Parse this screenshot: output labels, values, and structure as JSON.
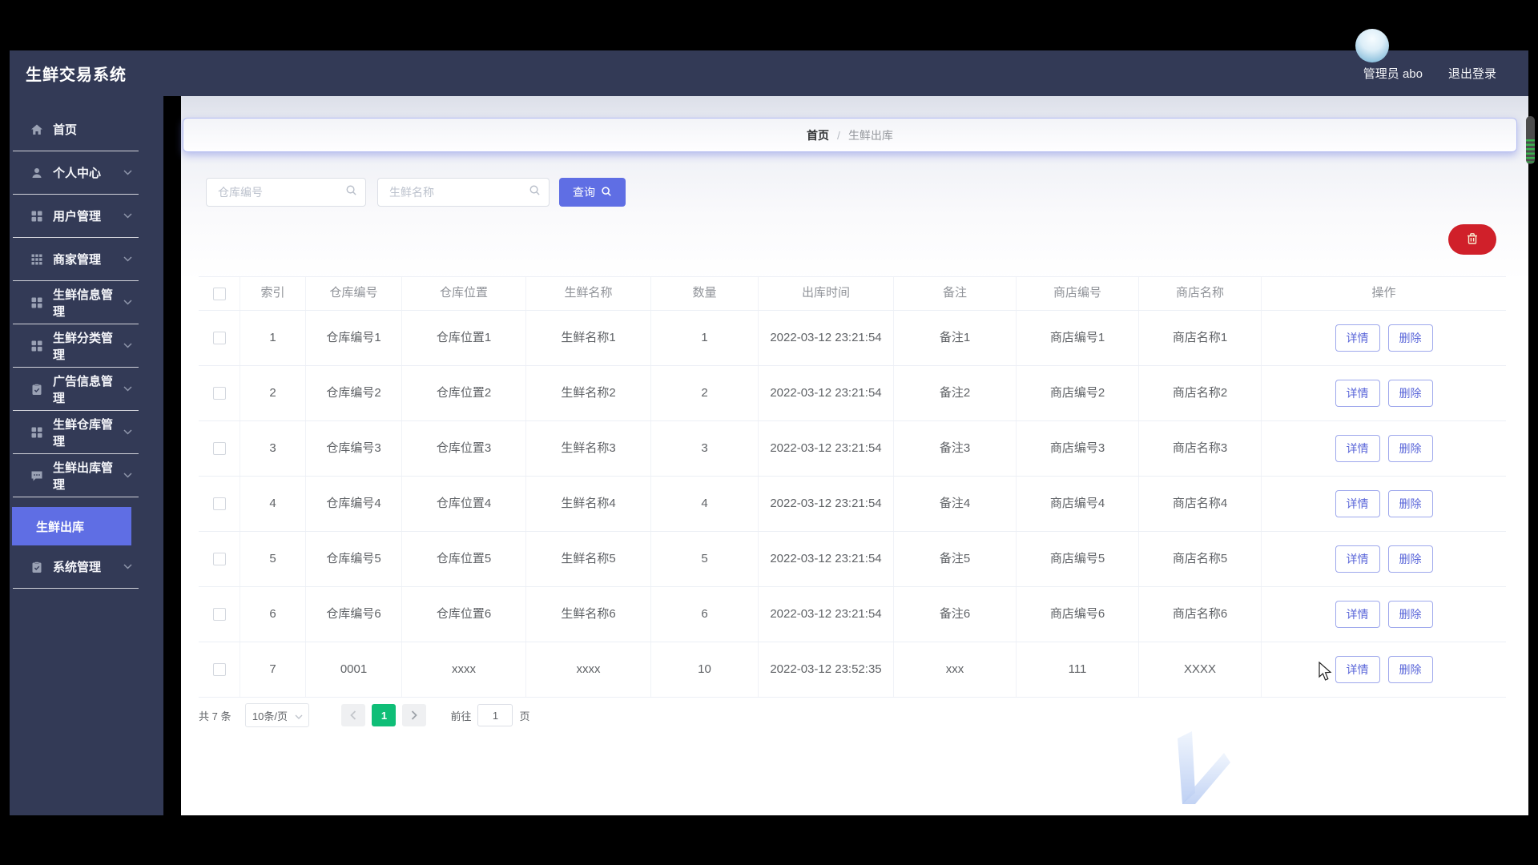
{
  "app": {
    "title": "生鲜交易系统",
    "user": "管理员 abo",
    "logout": "退出登录"
  },
  "sidebar": {
    "items": [
      {
        "label": "首页",
        "icon": "home-icon",
        "chevron": false
      },
      {
        "label": "个人中心",
        "icon": "user-icon",
        "chevron": true
      },
      {
        "label": "用户管理",
        "icon": "grid-icon",
        "chevron": true
      },
      {
        "label": "商家管理",
        "icon": "dots-grid-icon",
        "chevron": true
      },
      {
        "label": "生鲜信息管理",
        "icon": "grid-icon",
        "chevron": true
      },
      {
        "label": "生鲜分类管理",
        "icon": "grid-icon",
        "chevron": true
      },
      {
        "label": "广告信息管理",
        "icon": "clipboard-icon",
        "chevron": true
      },
      {
        "label": "生鲜仓库管理",
        "icon": "grid-icon",
        "chevron": true
      },
      {
        "label": "生鲜出库管理",
        "icon": "chat-icon",
        "chevron": true
      }
    ],
    "active_item": "生鲜出库",
    "bottom_items": [
      {
        "label": "系统管理",
        "icon": "clipboard-icon",
        "chevron": true
      }
    ]
  },
  "breadcrumb": {
    "home": "首页",
    "separator": "/",
    "current": "生鲜出库"
  },
  "filters": {
    "warehouse_placeholder": "仓库编号",
    "fresh_placeholder": "生鲜名称",
    "search_label": "查询",
    "search_icon": "search-icon",
    "bulk_delete_icon": "trash-icon"
  },
  "table": {
    "headers": [
      "索引",
      "仓库编号",
      "仓库位置",
      "生鲜名称",
      "数量",
      "出库时间",
      "备注",
      "商店编号",
      "商店名称",
      "操作"
    ],
    "actions": {
      "detail": "详情",
      "delete": "删除"
    },
    "rows": [
      {
        "index": "1",
        "warehouse_no": "仓库编号1",
        "location": "仓库位置1",
        "fresh_name": "生鲜名称1",
        "quantity": "1",
        "out_time": "2022-03-12 23:21:54",
        "remark": "备注1",
        "shop_no": "商店编号1",
        "shop_name": "商店名称1"
      },
      {
        "index": "2",
        "warehouse_no": "仓库编号2",
        "location": "仓库位置2",
        "fresh_name": "生鲜名称2",
        "quantity": "2",
        "out_time": "2022-03-12 23:21:54",
        "remark": "备注2",
        "shop_no": "商店编号2",
        "shop_name": "商店名称2"
      },
      {
        "index": "3",
        "warehouse_no": "仓库编号3",
        "location": "仓库位置3",
        "fresh_name": "生鲜名称3",
        "quantity": "3",
        "out_time": "2022-03-12 23:21:54",
        "remark": "备注3",
        "shop_no": "商店编号3",
        "shop_name": "商店名称3"
      },
      {
        "index": "4",
        "warehouse_no": "仓库编号4",
        "location": "仓库位置4",
        "fresh_name": "生鲜名称4",
        "quantity": "4",
        "out_time": "2022-03-12 23:21:54",
        "remark": "备注4",
        "shop_no": "商店编号4",
        "shop_name": "商店名称4"
      },
      {
        "index": "5",
        "warehouse_no": "仓库编号5",
        "location": "仓库位置5",
        "fresh_name": "生鲜名称5",
        "quantity": "5",
        "out_time": "2022-03-12 23:21:54",
        "remark": "备注5",
        "shop_no": "商店编号5",
        "shop_name": "商店名称5"
      },
      {
        "index": "6",
        "warehouse_no": "仓库编号6",
        "location": "仓库位置6",
        "fresh_name": "生鲜名称6",
        "quantity": "6",
        "out_time": "2022-03-12 23:21:54",
        "remark": "备注6",
        "shop_no": "商店编号6",
        "shop_name": "商店名称6"
      },
      {
        "index": "7",
        "warehouse_no": "0001",
        "location": "xxxx",
        "fresh_name": "xxxx",
        "quantity": "10",
        "out_time": "2022-03-12 23:52:35",
        "remark": "xxx",
        "shop_no": "111",
        "shop_name": "XXXX"
      }
    ]
  },
  "pagination": {
    "total": "共 7 条",
    "page_size": "10条/页",
    "prev": "‹",
    "current_page": "1",
    "next": "›",
    "goto_label": "前往",
    "goto_value": "1",
    "page_unit": "页"
  },
  "colors": {
    "navy": "#333a56",
    "accent": "#5f6ee4",
    "active_page_green": "#0fbe77",
    "bulk_delete_red": "#d0202a",
    "table_border": "#eceff5"
  }
}
